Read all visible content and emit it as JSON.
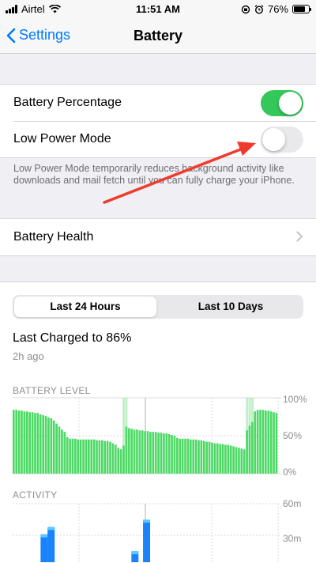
{
  "status": {
    "carrier": "Airtel",
    "time": "11:51 AM",
    "battery": "76%"
  },
  "nav": {
    "back_label": "Settings",
    "title": "Battery"
  },
  "settings": {
    "battery_percentage_label": "Battery Percentage",
    "battery_percentage_on": true,
    "low_power_label": "Low Power Mode",
    "low_power_on": false,
    "low_power_note": "Low Power Mode temporarily reduces background activity like downloads and mail fetch until you can fully charge your iPhone.",
    "battery_health_label": "Battery Health"
  },
  "usage": {
    "tabs": [
      "Last 24 Hours",
      "Last 10 Days"
    ],
    "selected_tab": "Last 24 Hours",
    "last_charged": "Last Charged to 86%",
    "last_charged_time": "2h ago",
    "battery_level_label": "BATTERY LEVEL",
    "activity_label": "ACTIVITY"
  },
  "chart_data": [
    {
      "type": "bar",
      "title": "BATTERY LEVEL",
      "yticks": [
        "100%",
        "50%",
        "0%"
      ],
      "ylim": [
        0,
        100
      ],
      "values": [
        84,
        84,
        83,
        83,
        82,
        82,
        81,
        81,
        80,
        80,
        78,
        77,
        76,
        74,
        73,
        70,
        66,
        62,
        58,
        55,
        48,
        46,
        46,
        46,
        45,
        45,
        45,
        45,
        45,
        45,
        45,
        44,
        44,
        44,
        43,
        43,
        42,
        40,
        38,
        34,
        32,
        37,
        62,
        60,
        59,
        58,
        58,
        57,
        57,
        56,
        56,
        55,
        55,
        55,
        54,
        54,
        53,
        53,
        52,
        51,
        50,
        47,
        46,
        46,
        46,
        46,
        45,
        45,
        45,
        44,
        44,
        43,
        42,
        42,
        41,
        40,
        40,
        39,
        39,
        38,
        38,
        37,
        36,
        35,
        34,
        33,
        32,
        57,
        63,
        68,
        82,
        84,
        84,
        84,
        83,
        83,
        82,
        81,
        80
      ],
      "charging_flags": [
        41,
        42,
        87,
        88,
        89
      ],
      "colors": {
        "bar": "#4cd964",
        "charging": "#a6e8ae"
      }
    },
    {
      "type": "bar",
      "title": "ACTIVITY",
      "yticks": [
        "60m",
        "30m"
      ],
      "ylim": [
        0,
        60
      ],
      "values": [
        0,
        0,
        0,
        0,
        0,
        0,
        0,
        0,
        0,
        0,
        0,
        0,
        46,
        0,
        0,
        53,
        0,
        0,
        0,
        0,
        0,
        0,
        0,
        2,
        0,
        0,
        0,
        0,
        0,
        0,
        0,
        0,
        9,
        0,
        0,
        0,
        0,
        0,
        0,
        0,
        0,
        0,
        0,
        0,
        0,
        0,
        0,
        0,
        0,
        0,
        0,
        30,
        0,
        0,
        0,
        0,
        60,
        0,
        0,
        0,
        0,
        0,
        0,
        0,
        0,
        0,
        0,
        0,
        0,
        0,
        0,
        0,
        0,
        0,
        0,
        0,
        0,
        0,
        0,
        0,
        0,
        0,
        0,
        0,
        0,
        0,
        0,
        0,
        0,
        0,
        16,
        0,
        0,
        0,
        0,
        0,
        0,
        0,
        0,
        16,
        0,
        0,
        0,
        16,
        0,
        0,
        0,
        0,
        0,
        0,
        0,
        0,
        0,
        4
      ],
      "colors": {
        "bar": "#1a82fb",
        "secondary": "#5ac8fa"
      }
    }
  ]
}
